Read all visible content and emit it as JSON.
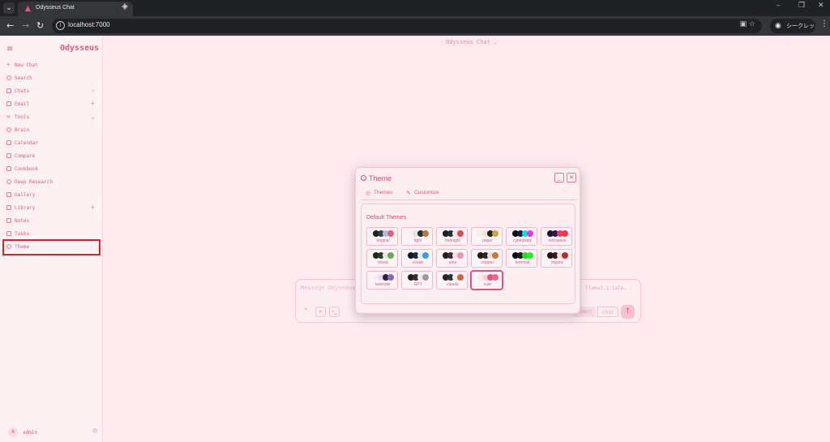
{
  "browser": {
    "tab_title": "Odysseus Chat",
    "url": "localhost:7000",
    "incognito_label": "シークレット"
  },
  "sidebar": {
    "brand": "Odysseus",
    "items": [
      {
        "label": "New Chat",
        "icon": "plus-icon",
        "aux": ""
      },
      {
        "label": "Search",
        "icon": "search-icon",
        "aux": ""
      },
      {
        "label": "Chats",
        "icon": "chat-bubble-icon",
        "aux": "›"
      },
      {
        "label": "Email",
        "icon": "mail-icon",
        "aux": "+"
      },
      {
        "label": "Tools",
        "icon": "wrench-icon",
        "aux": "⌄"
      },
      {
        "label": "Brain",
        "icon": "brain-icon",
        "aux": ""
      },
      {
        "label": "Calendar",
        "icon": "calendar-icon",
        "aux": ""
      },
      {
        "label": "Compare",
        "icon": "compare-icon",
        "aux": ""
      },
      {
        "label": "Cookbook",
        "icon": "book-icon",
        "aux": ""
      },
      {
        "label": "Deep Research",
        "icon": "research-icon",
        "aux": ""
      },
      {
        "label": "Gallery",
        "icon": "gallery-icon",
        "aux": ""
      },
      {
        "label": "Library",
        "icon": "library-icon",
        "aux": "+"
      },
      {
        "label": "Notes",
        "icon": "notes-icon",
        "aux": ""
      },
      {
        "label": "Tasks",
        "icon": "tasks-icon",
        "aux": ""
      },
      {
        "label": "Theme",
        "icon": "palette-icon",
        "aux": ""
      }
    ],
    "user": {
      "initial": "A",
      "name": "admin"
    }
  },
  "header": {
    "model_selector": "Odysseus Chat ⌄"
  },
  "composer": {
    "placeholder": "Message Odysseus",
    "model": "llama3.1:late…",
    "agent_label": "Agent",
    "chat_label": "Chat"
  },
  "theme_modal": {
    "title": "Theme",
    "tabs": [
      {
        "label": "Themes",
        "icon": "palette-icon"
      },
      {
        "label": "Customize",
        "icon": "brush-icon"
      }
    ],
    "section_title": "Default Themes",
    "selected": "cute",
    "themes": [
      {
        "name": "original",
        "colors": [
          "#1f1f1f",
          "#3a3a3a",
          "#9ec5e8",
          "#e85d75"
        ]
      },
      {
        "name": "light",
        "colors": [
          "#f3f3f3",
          "#e5e5e5",
          "#2b2b2b",
          "#b07a3c"
        ]
      },
      {
        "name": "midnight",
        "colors": [
          "#1c1c24",
          "#2a2a36",
          "#e8e8e8",
          "#e0484e"
        ]
      },
      {
        "name": "paper",
        "colors": [
          "#f6f1e4",
          "#ece4cf",
          "#222222",
          "#c9a73a"
        ]
      },
      {
        "name": "cyberpunk",
        "colors": [
          "#0d0d1a",
          "#1a1a33",
          "#19d8e8",
          "#e83ad8"
        ]
      },
      {
        "name": "retrowave",
        "colors": [
          "#1b1033",
          "#2a1a4a",
          "#e83a6a",
          "#e8384a"
        ]
      },
      {
        "name": "forest",
        "colors": [
          "#1b2a1b",
          "#2a3a2a",
          "#e8e8e8",
          "#6aa84f"
        ]
      },
      {
        "name": "ocean",
        "colors": [
          "#0e1a2a",
          "#1a2a3e",
          "#e8e8e8",
          "#3a9ae8"
        ]
      },
      {
        "name": "ume",
        "colors": [
          "#2a1a22",
          "#3a2a32",
          "#f0e0e8",
          "#e893b8"
        ]
      },
      {
        "name": "copper",
        "colors": [
          "#1e1a16",
          "#2e2820",
          "#e8e0d8",
          "#c87a3a"
        ]
      },
      {
        "name": "terminal",
        "colors": [
          "#0a0a0a",
          "#1a1a1a",
          "#22dd22",
          "#22ee22"
        ]
      },
      {
        "name": "organs",
        "colors": [
          "#2a1010",
          "#3a1a1a",
          "#f0e0e0",
          "#b03030"
        ]
      },
      {
        "name": "lavender",
        "colors": [
          "#f3eefa",
          "#e6dcf5",
          "#2a2238",
          "#8a63c8"
        ]
      },
      {
        "name": "GPT",
        "colors": [
          "#212121",
          "#2f2f2f",
          "#ececec",
          "#9a9a9a"
        ]
      },
      {
        "name": "claude",
        "colors": [
          "#262624",
          "#30302e",
          "#f0eee6",
          "#c96a42"
        ]
      },
      {
        "name": "cute",
        "colors": [
          "#fde9ee",
          "#f8d0dc",
          "#e5537c",
          "#e06a94"
        ]
      }
    ]
  }
}
